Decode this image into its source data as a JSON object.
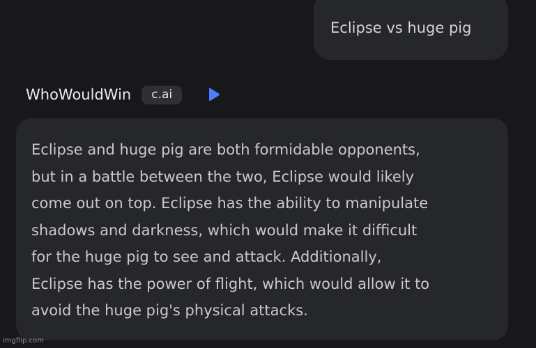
{
  "user_message": {
    "text": "Eclipse vs huge pig"
  },
  "bot": {
    "name": "WhoWouldWin",
    "badge": "c.ai",
    "play_icon": "play-icon",
    "accent": "#4f7cff",
    "message_lines": [
      "Eclipse and huge pig are both formidable opponents,",
      "but in a battle between the two, Eclipse would likely",
      "come out on top. Eclipse has the ability to manipulate",
      "shadows and darkness, which would make it difficult",
      "for the huge pig to see and attack. Additionally,",
      "Eclipse has the power of flight, which would allow it to",
      "avoid the huge pig's physical attacks."
    ]
  },
  "watermark": "imgflip.com"
}
